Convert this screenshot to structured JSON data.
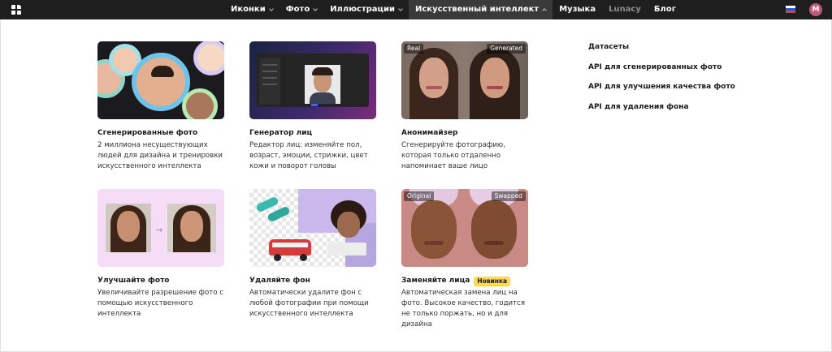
{
  "nav": {
    "items": [
      {
        "label": "Иконки"
      },
      {
        "label": "Фото"
      },
      {
        "label": "Иллюстрации"
      },
      {
        "label": "Искусственный интеллект"
      },
      {
        "label": "Музыка"
      },
      {
        "label": "Lunacy"
      },
      {
        "label": "Блог"
      }
    ],
    "avatar_initial": "M"
  },
  "cards": [
    {
      "title": "Сгенерированные фото",
      "desc": "2 миллиона несуществующих людей для дизайна и тренировки искусственного интеллекта"
    },
    {
      "title": "Генератор лиц",
      "desc": "Редактор лиц: изменяйте пол, возраст, эмоции, стрижки, цвет кожи и поворот головы"
    },
    {
      "title": "Анонимайзер",
      "desc": "Сгенерируйте фотографию, которая только отдаленно напоминает ваше лицо",
      "tags": [
        "Real",
        "Generated"
      ]
    },
    {
      "title": "Улучшайте фото",
      "desc": "Увеличивайте разрешение фото с помощью искусственного интеллекта"
    },
    {
      "title": "Удаляйте фон",
      "desc": "Автоматически удалите фон с любой фотографии при помощи искусственного интеллекта"
    },
    {
      "title": "Заменяйте лица",
      "badge": "Новинка",
      "desc": "Автоматическая замена лиц на фото. Высокое качество, годится не только поржать, но и для дизайна",
      "tags": [
        "Original",
        "Swapped"
      ]
    }
  ],
  "side_links": [
    "Датасеты",
    "API для сгенерированных фото",
    "API для улучшения качества фото",
    "API для удаления фона"
  ],
  "colors": {
    "topbar": "#1f1f1f",
    "badge": "#ffd84d",
    "avatar": "#c0587e"
  }
}
